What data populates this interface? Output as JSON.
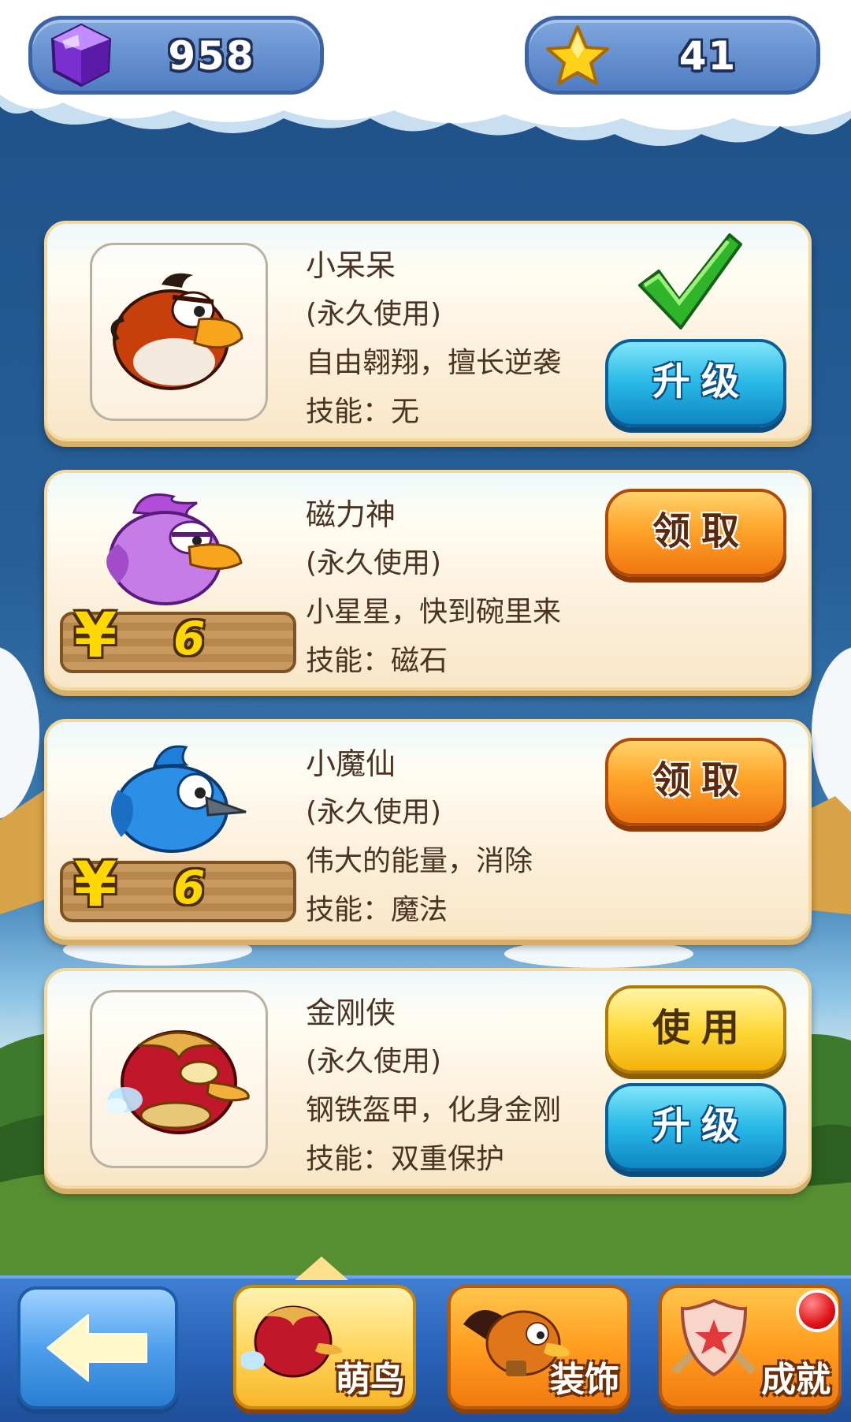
{
  "hud": {
    "gems": {
      "icon": "gem-icon",
      "value": "958"
    },
    "stars": {
      "icon": "star-icon",
      "value": "41"
    }
  },
  "characters": [
    {
      "name": "小呆呆",
      "duration": "(永久使用)",
      "description": "自由翱翔，擅长逆袭",
      "skill": "技能：无",
      "owned": true,
      "selected": true,
      "buttons": [
        "升级"
      ]
    },
    {
      "name": "磁力神",
      "duration": "(永久使用)",
      "description": "小星星，快到碗里来",
      "skill": "技能：磁石",
      "owned": false,
      "price": {
        "currency": "¥",
        "amount": "6"
      },
      "buttons": [
        "领取"
      ]
    },
    {
      "name": "小魔仙",
      "duration": "(永久使用)",
      "description": "伟大的能量，消除",
      "skill": "技能：魔法",
      "owned": false,
      "price": {
        "currency": "¥",
        "amount": "6"
      },
      "buttons": [
        "领取"
      ]
    },
    {
      "name": "金刚侠",
      "duration": "(永久使用)",
      "description": "钢铁盔甲，化身金刚",
      "skill": "技能：双重保护",
      "owned": true,
      "buttons": [
        "使用",
        "升级"
      ]
    }
  ],
  "nav": {
    "back": {
      "icon": "back-arrow-icon"
    },
    "tabs": [
      {
        "label": "萌鸟",
        "active": true
      },
      {
        "label": "装饰",
        "active": false
      },
      {
        "label": "成就",
        "active": false,
        "notification": true
      }
    ]
  },
  "colors": {
    "upgrade_button": "#28b8e6",
    "claim_button": "#ffa52a",
    "use_button": "#ffd93a",
    "price_text": "#ffd800"
  }
}
